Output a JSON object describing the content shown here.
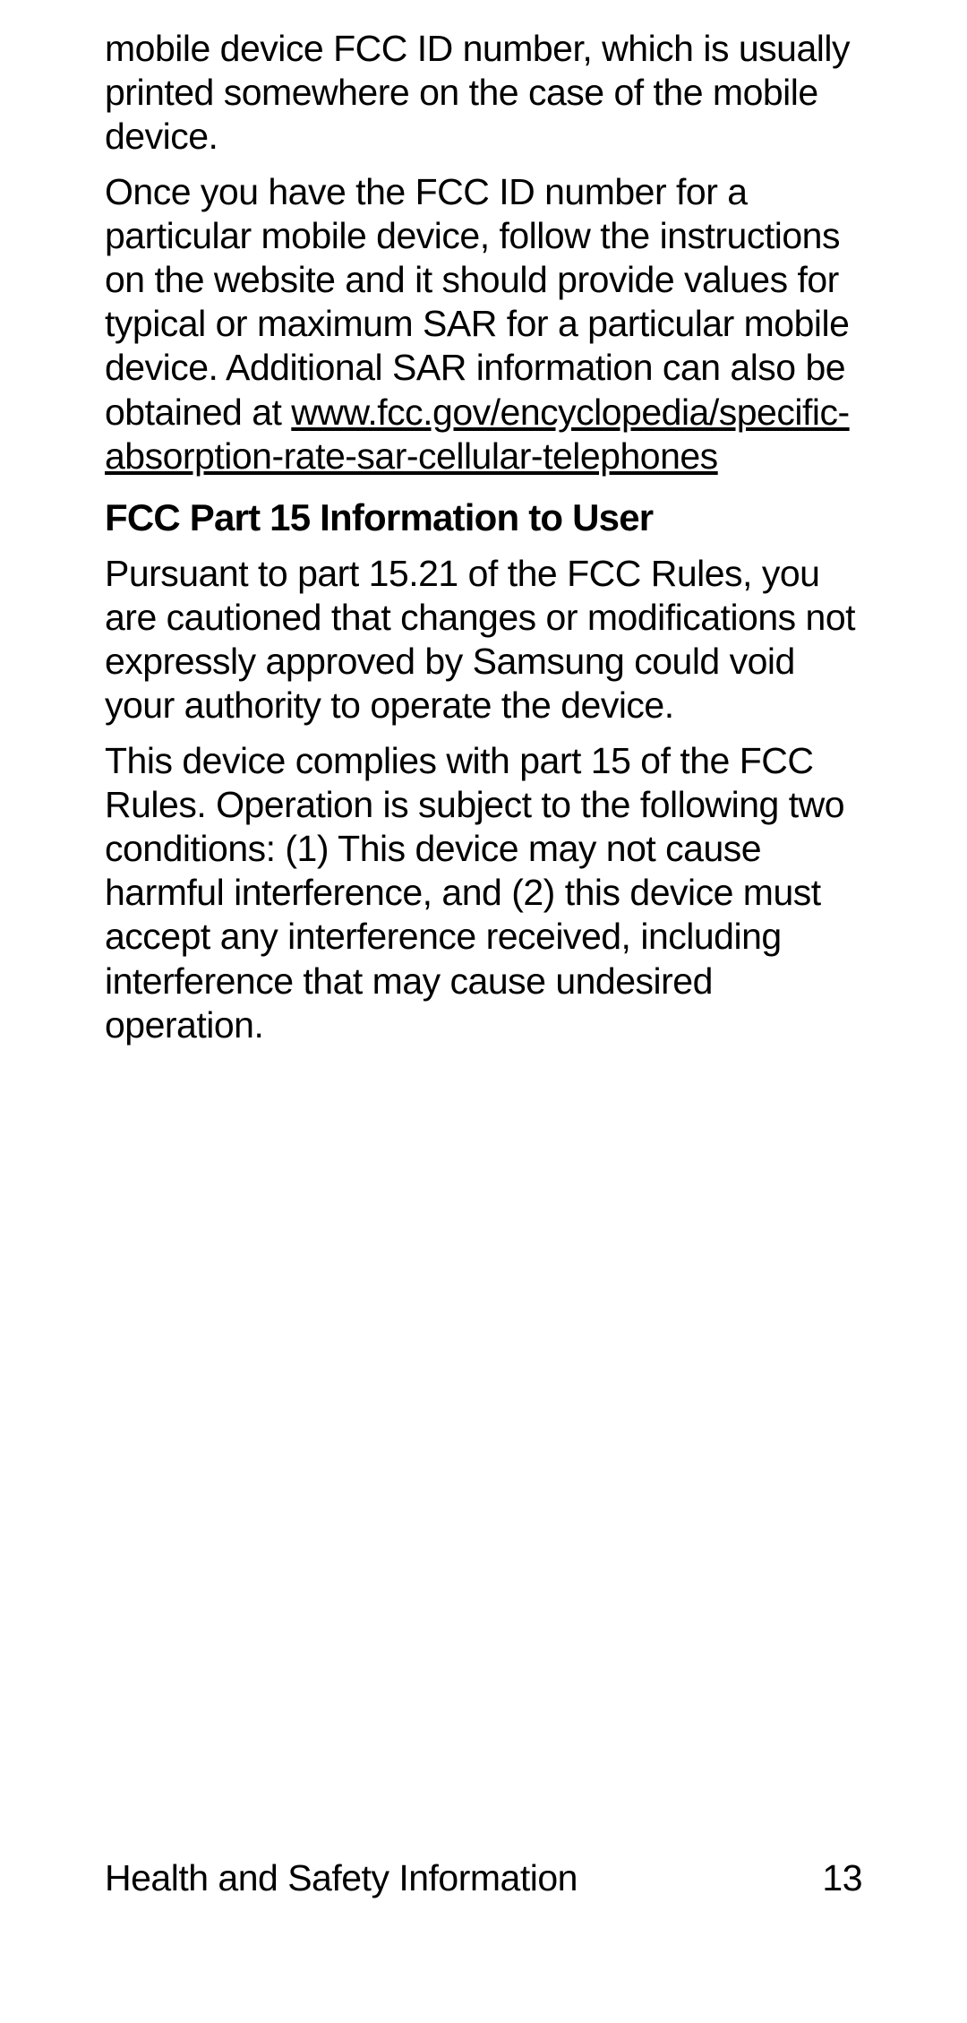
{
  "body": {
    "paragraph1": "mobile device FCC ID number, which is usually printed somewhere on the case of the mobile device.",
    "paragraph2_part1": "Once you have the FCC ID number for a particular mobile device, follow the instructions on the website and it should provide values for typical or maximum SAR for a particular mobile device. Additional SAR information can also be obtained at ",
    "paragraph2_link": "www.fcc.gov/encyclopedia/specific-absorption-rate-sar-cellular-telephones",
    "heading": "FCC Part 15 Information to User",
    "paragraph3": "Pursuant to part 15.21 of the FCC Rules, you are cautioned that changes or modifications not expressly approved by Samsung could void your authority to operate the device.",
    "paragraph4": "This device complies with part 15 of the FCC Rules. Operation is subject to the following two conditions: (1) This device may not cause harmful interference, and (2) this device must accept any interference received, including interference that may cause undesired operation."
  },
  "footer": {
    "section_title": "Health and Safety Information",
    "page_number": "13"
  }
}
